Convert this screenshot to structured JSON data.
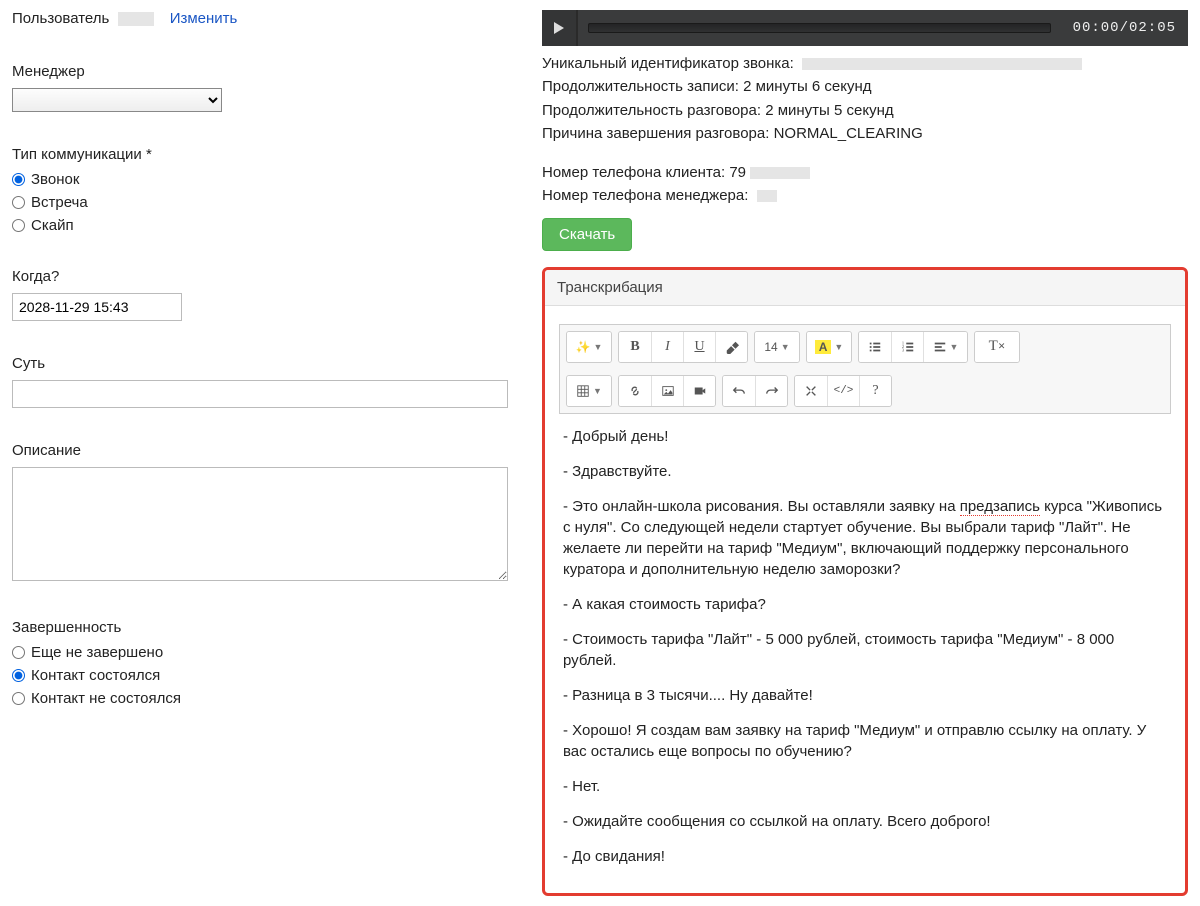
{
  "left": {
    "user_label": "Пользователь",
    "change_link": "Изменить",
    "manager_label": "Менеджер",
    "comm_type_label": "Тип коммуникации *",
    "comm_options": [
      "Звонок",
      "Встреча",
      "Скайп"
    ],
    "comm_selected": 0,
    "when_label": "Когда?",
    "when_value": "2028-11-29 15:43",
    "subject_label": "Суть",
    "subject_value": "",
    "desc_label": "Описание",
    "desc_value": "",
    "completion_label": "Завершенность",
    "completion_options": [
      "Еще не завершено",
      "Контакт состоялся",
      "Контакт не состоялся"
    ],
    "completion_selected": 1
  },
  "right": {
    "player": {
      "current": "00:00",
      "sep": "/",
      "total": "02:05"
    },
    "meta": {
      "call_id_label": "Уникальный идентификатор звонка:",
      "rec_duration": "Продолжительность записи: 2 минуты 6 секунд",
      "talk_duration": "Продолжительность разговора: 2 минуты 5 секунд",
      "end_reason": "Причина завершения разговора: NORMAL_CLEARING",
      "client_phone": "Номер телефона клиента: 79",
      "manager_phone": "Номер телефона менеджера:"
    },
    "download": "Скачать",
    "trans_title": "Транскрибация",
    "toolbar": {
      "font_size": "14",
      "color_letter": "A"
    },
    "transcript": [
      "- Добрый день!",
      "- Здравствуйте.",
      "- Это онлайн-школа рисования. Вы оставляли заявку на предзапись курса \"Живопись с нуля\".  Со следующей недели стартует обучение. Вы выбрали тариф \"Лайт\". Не желаете ли перейти на тариф \"Медиум\", включающий поддержку персонального куратора и дополнительную неделю заморозки?",
      "- А какая стоимость тарифа?",
      "- Стоимость тарифа \"Лайт\" - 5 000 рублей, стоимость тарифа \"Медиум\" - 8 000 рублей.",
      "- Разница в 3 тысячи.... Ну давайте!",
      "- Хорошо! Я создам вам заявку на тариф \"Медиум\" и отправлю ссылку на оплату. У вас остались еще вопросы по обучению?",
      "- Нет.",
      "- Ожидайте сообщения со ссылкой на оплату. Всего доброго!",
      "- До свидания!"
    ]
  }
}
